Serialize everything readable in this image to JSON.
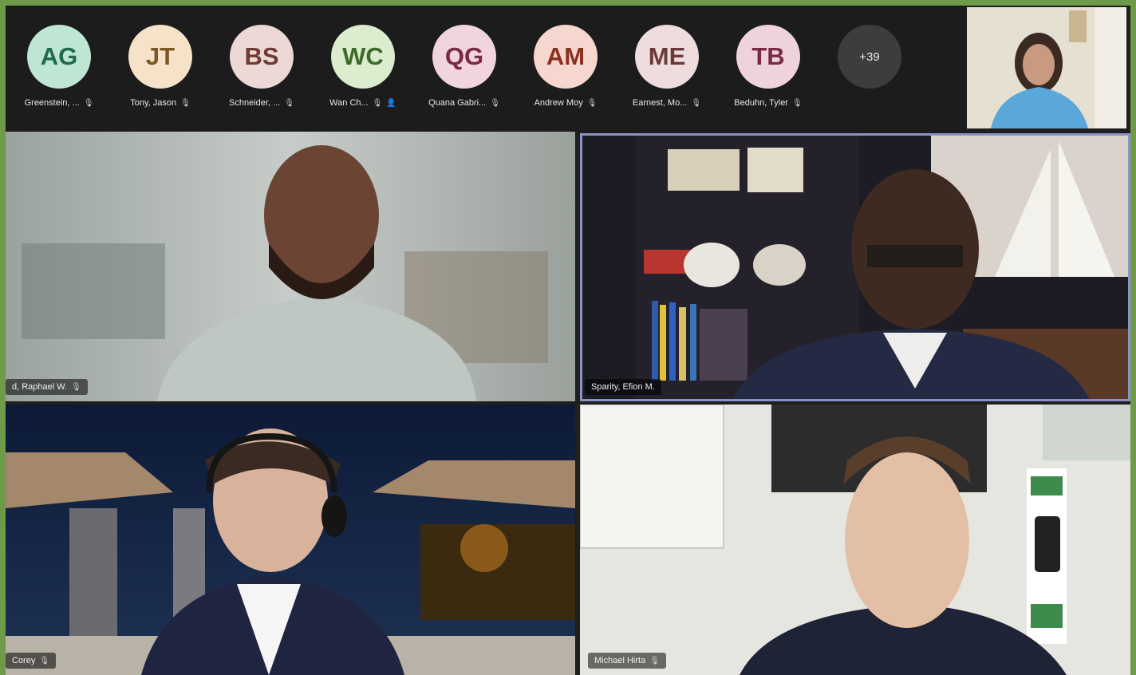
{
  "participants": [
    {
      "initials": "AG",
      "name": "Greenstein, ...",
      "bg": "#bfe6d3",
      "fg": "#1f6b4b"
    },
    {
      "initials": "JT",
      "name": "Tony, Jason",
      "bg": "#f6e2c8",
      "fg": "#7a5826"
    },
    {
      "initials": "BS",
      "name": "Schneider, ...",
      "bg": "#ecd9d6",
      "fg": "#6e3a33"
    },
    {
      "initials": "WC",
      "name": "Wan Ch...",
      "bg": "#dbeccf",
      "fg": "#3d6b27"
    },
    {
      "initials": "QG",
      "name": "Quana Gabri...",
      "bg": "#f1d5de",
      "fg": "#7a2a45"
    },
    {
      "initials": "AM",
      "name": "Andrew Moy",
      "bg": "#f6d7cf",
      "fg": "#8a3021"
    },
    {
      "initials": "ME",
      "name": "Earnest, Mo...",
      "bg": "#efdcdc",
      "fg": "#6a3a3a"
    },
    {
      "initials": "TB",
      "name": "Beduhn, Tyler",
      "bg": "#efd3db",
      "fg": "#7a2a45"
    }
  ],
  "more_count": "+39",
  "tiles": [
    {
      "name": "d, Raphael W."
    },
    {
      "name": "Sparity, Efion M."
    },
    {
      "name": "Corey"
    },
    {
      "name": "Michael Hirta"
    }
  ],
  "icons": {
    "mic": "microphone-icon",
    "person": "person-icon"
  }
}
